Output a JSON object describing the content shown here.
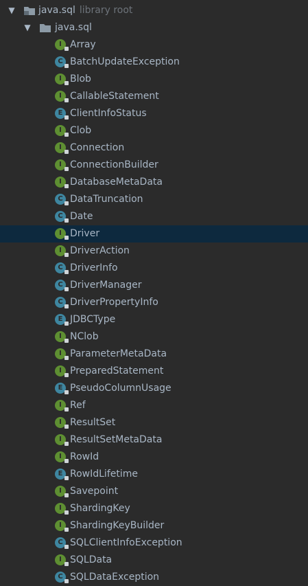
{
  "tree": {
    "root": {
      "label": "java.sql",
      "hint": "library root"
    },
    "package": {
      "label": "java.sql"
    },
    "items": [
      {
        "label": "Array",
        "kind": "I"
      },
      {
        "label": "BatchUpdateException",
        "kind": "C"
      },
      {
        "label": "Blob",
        "kind": "I"
      },
      {
        "label": "CallableStatement",
        "kind": "I"
      },
      {
        "label": "ClientInfoStatus",
        "kind": "E"
      },
      {
        "label": "Clob",
        "kind": "I"
      },
      {
        "label": "Connection",
        "kind": "I"
      },
      {
        "label": "ConnectionBuilder",
        "kind": "I"
      },
      {
        "label": "DatabaseMetaData",
        "kind": "I"
      },
      {
        "label": "DataTruncation",
        "kind": "C"
      },
      {
        "label": "Date",
        "kind": "C"
      },
      {
        "label": "Driver",
        "kind": "I",
        "selected": true
      },
      {
        "label": "DriverAction",
        "kind": "I"
      },
      {
        "label": "DriverInfo",
        "kind": "C"
      },
      {
        "label": "DriverManager",
        "kind": "C"
      },
      {
        "label": "DriverPropertyInfo",
        "kind": "C"
      },
      {
        "label": "JDBCType",
        "kind": "E"
      },
      {
        "label": "NClob",
        "kind": "I"
      },
      {
        "label": "ParameterMetaData",
        "kind": "I"
      },
      {
        "label": "PreparedStatement",
        "kind": "I"
      },
      {
        "label": "PseudoColumnUsage",
        "kind": "E"
      },
      {
        "label": "Ref",
        "kind": "I"
      },
      {
        "label": "ResultSet",
        "kind": "I"
      },
      {
        "label": "ResultSetMetaData",
        "kind": "I"
      },
      {
        "label": "RowId",
        "kind": "I"
      },
      {
        "label": "RowIdLifetime",
        "kind": "E"
      },
      {
        "label": "Savepoint",
        "kind": "I"
      },
      {
        "label": "ShardingKey",
        "kind": "I"
      },
      {
        "label": "ShardingKeyBuilder",
        "kind": "I"
      },
      {
        "label": "SQLClientInfoException",
        "kind": "C"
      },
      {
        "label": "SQLData",
        "kind": "I"
      },
      {
        "label": "SQLDataException",
        "kind": "C"
      }
    ]
  },
  "icons": {
    "expanded": "chevron-down-icon",
    "folder": "package-folder-icon",
    "interface": "interface-icon",
    "class": "class-icon",
    "enum": "enum-icon"
  },
  "colors": {
    "background": "#2b2b2b",
    "selection": "#0d293e",
    "text": "#a9b7c6",
    "hint": "#6d737a",
    "interface_badge": "#5e8f32",
    "class_badge": "#3e86a0"
  }
}
